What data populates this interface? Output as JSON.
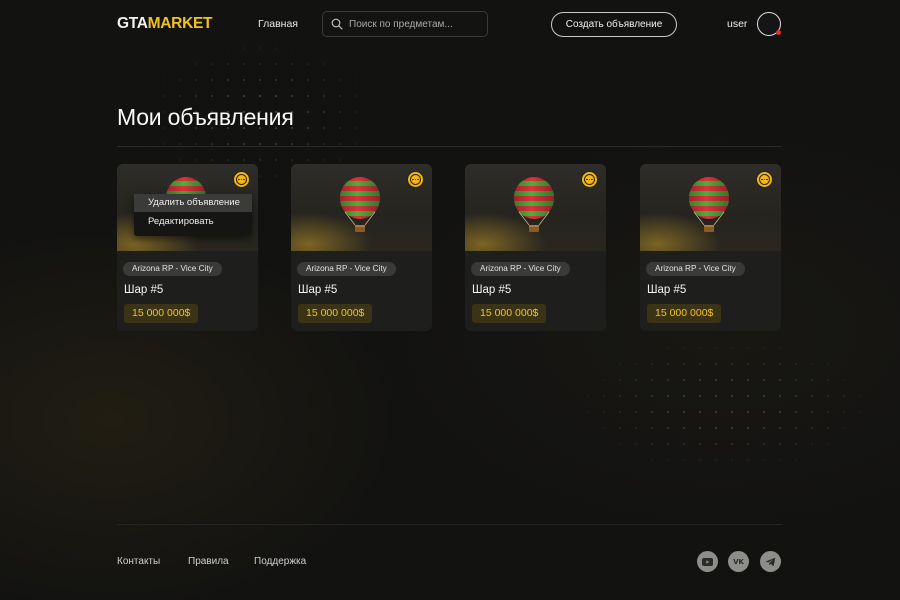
{
  "header": {
    "logo_part1": "GTA",
    "logo_part2": "MARKET",
    "nav_home": "Главная",
    "search_placeholder": "Поиск по предметам...",
    "create_button": "Создать объявление",
    "username": "user"
  },
  "page": {
    "title": "Мои объявления"
  },
  "listings": [
    {
      "server": "Arizona RP - Vice City",
      "name": "Шар #5",
      "price": "15 000 000$"
    },
    {
      "server": "Arizona RP - Vice City",
      "name": "Шар #5",
      "price": "15 000 000$"
    },
    {
      "server": "Arizona RP - Vice City",
      "name": "Шар #5",
      "price": "15 000 000$"
    },
    {
      "server": "Arizona RP - Vice City",
      "name": "Шар #5",
      "price": "15 000 000$"
    }
  ],
  "context_menu": {
    "delete": "Удалить объявление",
    "edit": "Редактировать"
  },
  "footer": {
    "links": [
      "Контакты",
      "Правила",
      "Поддержка"
    ],
    "socials": [
      "youtube-icon",
      "vk-icon",
      "telegram-icon"
    ]
  },
  "colors": {
    "accent": "#f2c21c",
    "background": "#121211",
    "card": "#1e1e1d",
    "price_bg": "#3a3316"
  }
}
